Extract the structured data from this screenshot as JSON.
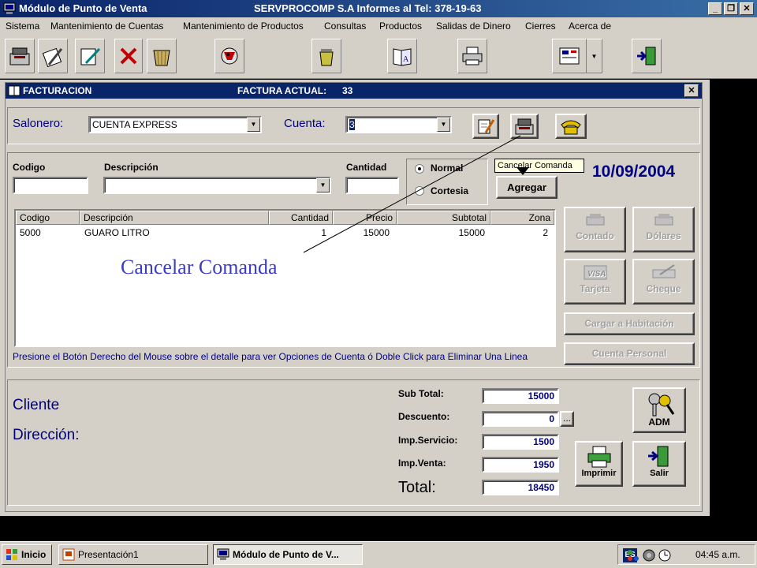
{
  "window": {
    "title": "Módulo de Punto de Venta",
    "company": "SERVPROCOMP S.A  Informes al Tel: 378-19-63",
    "controls": [
      "_",
      "❐",
      "✕"
    ]
  },
  "menu": [
    "Sistema",
    "Mantenimiento de Cuentas",
    "Mantenimiento de Productos",
    "Consultas",
    "Productos",
    "Salidas de Dinero",
    "Cierres",
    "Acerca de"
  ],
  "toolbar_icons": [
    "cash-register-icon",
    "edit-icon",
    "edit-pen-icon",
    "delete-icon",
    "basket-icon",
    "bird-icon",
    "trash-can-icon",
    "book-icon",
    "printer-icon",
    "calculator-icon",
    "exit-door-icon"
  ],
  "form": {
    "title": "FACTURACION",
    "factura_label": "FACTURA ACTUAL:",
    "factura_number": "33",
    "salonero_label": "Salonero:",
    "salonero_value": "CUENTA EXPRESS",
    "cuenta_label": "Cuenta:",
    "cuenta_value": "3",
    "codigo_label": "Codigo",
    "descripcion_label": "Descripción",
    "cantidad_label": "Cantidad",
    "radio_normal": "Normal",
    "radio_cortesia": "Cortesia",
    "agregar": "Agregar",
    "tooltip": "Cancelar Comanda",
    "date": "10/09/2004",
    "hint": "Presione el Botón Derecho del Mouse sobre el detalle para ver Opciones de Cuenta ó Doble Click para Eliminar Una Linea"
  },
  "grid": {
    "headers": [
      "Codigo",
      "Descripción",
      "Cantidad",
      "Precio",
      "Subtotal",
      "Zona"
    ],
    "rows": [
      [
        "5000",
        "GUARO LITRO",
        "1",
        "15000",
        "15000",
        "2"
      ]
    ]
  },
  "payment_buttons": {
    "contado": "Contado",
    "dolares": "Dólares",
    "tarjeta": "Tarjeta",
    "cheque": "Cheque",
    "habitacion": "Cargar a Habitación",
    "personal": "Cuenta Personal"
  },
  "totals": {
    "cliente_label": "Cliente",
    "direccion_label": "Dirección:",
    "subtotal_label": "Sub Total:",
    "subtotal": "15000",
    "descuento_label": "Descuento:",
    "descuento": "0",
    "descuento_btn": "...",
    "servicio_label": "Imp.Servicio:",
    "servicio": "1500",
    "venta_label": "Imp.Venta:",
    "venta": "1950",
    "total_label": "Total:",
    "total": "18450",
    "adm": "ADM",
    "imprimir": "Imprimir",
    "salir": "Salir"
  },
  "annotation": "Cancelar Comanda",
  "taskbar": {
    "start": "Inicio",
    "task1": "Presentación1",
    "task2": "Módulo de Punto de V...",
    "lang": "ES",
    "time": "04:45 a.m."
  },
  "colors": {
    "titlebar": "#0a246a",
    "face": "#d4d0c8",
    "value_text": "#000080",
    "annotation": "#3b3bc8"
  }
}
